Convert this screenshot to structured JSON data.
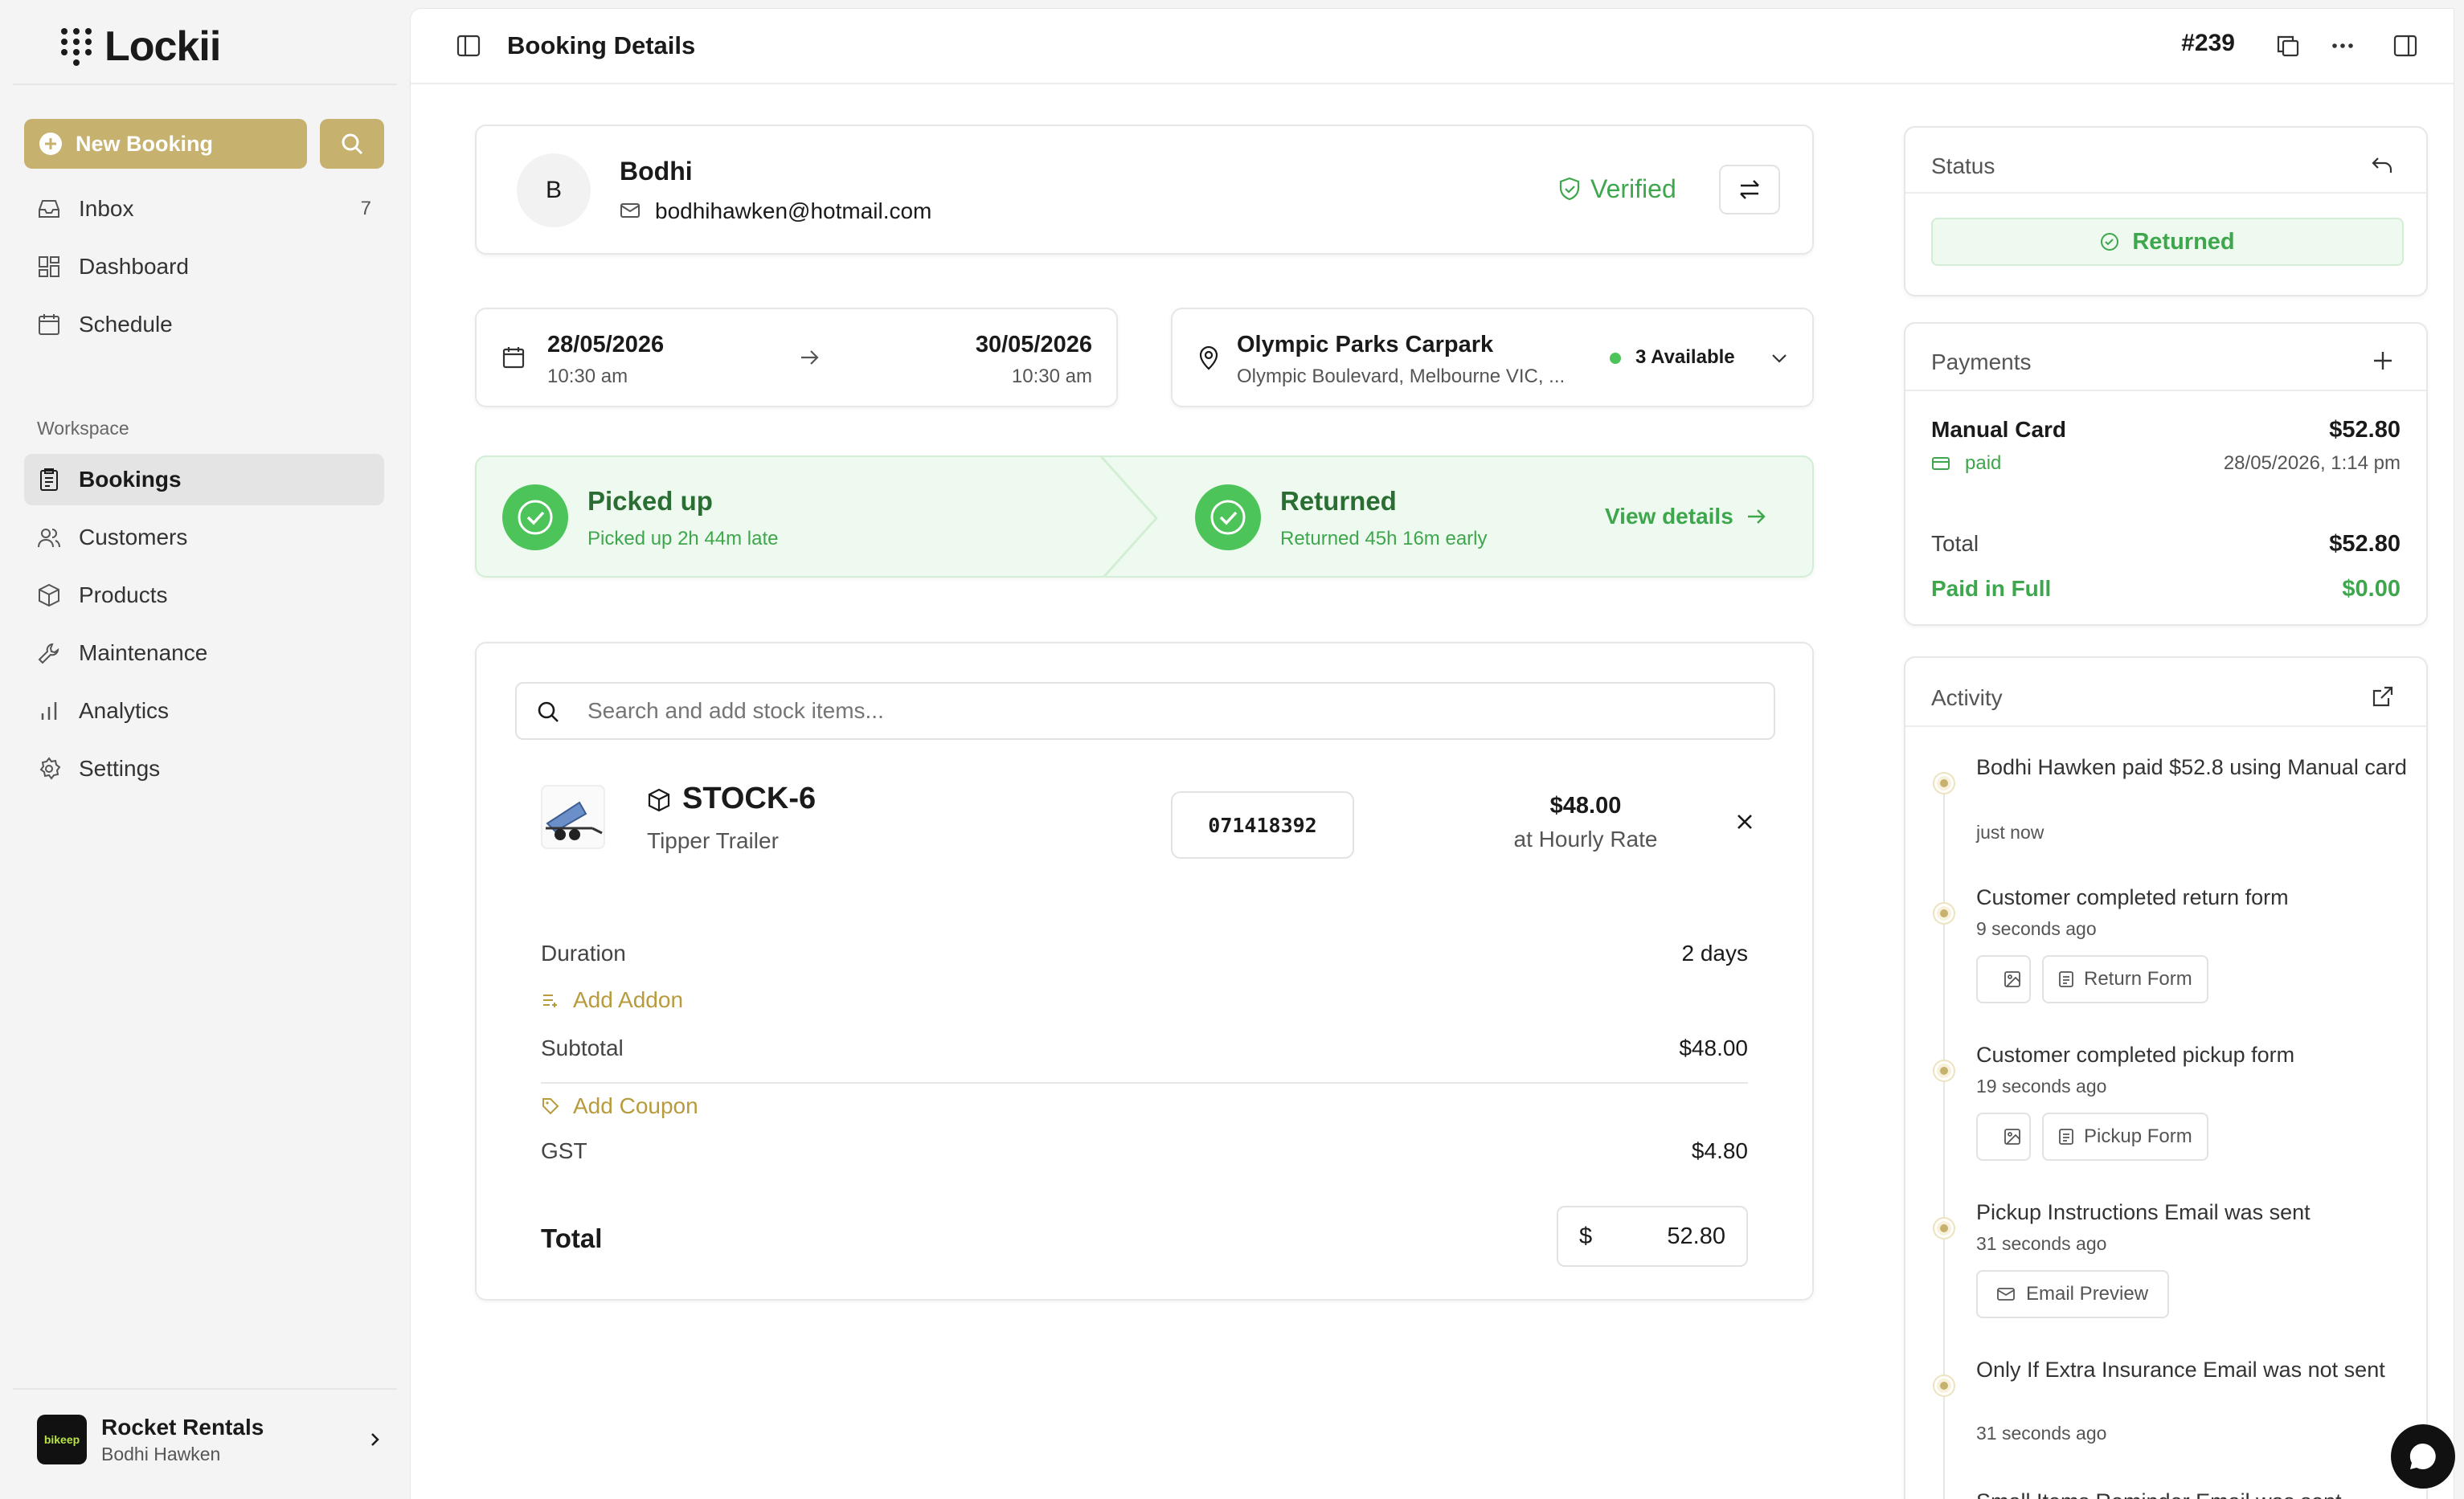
{
  "app": {
    "name": "Lockii"
  },
  "sidebar": {
    "new_booking_label": "New Booking",
    "items": [
      {
        "label": "Inbox",
        "count": "7"
      },
      {
        "label": "Dashboard"
      },
      {
        "label": "Schedule"
      }
    ],
    "workspace_label": "Workspace",
    "workspace_items": [
      {
        "label": "Bookings"
      },
      {
        "label": "Customers"
      },
      {
        "label": "Products"
      },
      {
        "label": "Maintenance"
      },
      {
        "label": "Analytics"
      },
      {
        "label": "Settings"
      }
    ],
    "org": {
      "logo_text": "bikeep",
      "name": "Rocket Rentals",
      "user": "Bodhi Hawken"
    }
  },
  "header": {
    "title": "Booking Details",
    "booking_number": "#239"
  },
  "customer": {
    "initial": "B",
    "name": "Bodhi",
    "email": "bodhihawken@hotmail.com",
    "verified_label": "Verified"
  },
  "dates": {
    "start_date": "28/05/2026",
    "start_time": "10:30 am",
    "end_date": "30/05/2026",
    "end_time": "10:30 am"
  },
  "location": {
    "name": "Olympic Parks Carpark",
    "address": "Olympic Boulevard, Melbourne VIC, ...",
    "availability": "3 Available"
  },
  "progress": {
    "picked_title": "Picked up",
    "picked_sub": "Picked up 2h 44m late",
    "returned_title": "Returned",
    "returned_sub": "Returned 45h 16m early",
    "view_details": "View details"
  },
  "items": {
    "search_placeholder": "Search and add stock items...",
    "stock": {
      "code": "STOCK-6",
      "type": "Tipper Trailer",
      "barcode": "071418392",
      "price": "$48.00",
      "rate": "at Hourly Rate"
    },
    "duration_label": "Duration",
    "duration_value": "2 days",
    "add_addon": "Add Addon",
    "subtotal_label": "Subtotal",
    "subtotal_value": "$48.00",
    "add_coupon": "Add Coupon",
    "gst_label": "GST",
    "gst_value": "$4.80",
    "total_label": "Total",
    "total_currency": "$",
    "total_value": "52.80"
  },
  "status": {
    "title": "Status",
    "value": "Returned"
  },
  "payments": {
    "title": "Payments",
    "method": "Manual Card",
    "amount": "$52.80",
    "state": "paid",
    "date": "28/05/2026, 1:14 pm",
    "total_label": "Total",
    "total_value": "$52.80",
    "paid_label": "Paid in Full",
    "paid_value": "$0.00"
  },
  "activity": {
    "title": "Activity",
    "events": [
      {
        "text": "Bodhi Hawken paid $52.8 using Manual card",
        "time": "just now"
      },
      {
        "text": "Customer completed return form",
        "time": "9 seconds ago",
        "attachment": "Return Form"
      },
      {
        "text": "Customer completed pickup form",
        "time": "19 seconds ago",
        "attachment": "Pickup Form"
      },
      {
        "text": "Pickup Instructions Email was sent",
        "time": "31 seconds ago",
        "attachment": "Email Preview"
      },
      {
        "text": "Only If Extra Insurance Email was not sent",
        "time": "31 seconds ago"
      },
      {
        "text": "Small Items Reminder Email was sent",
        "time": ""
      }
    ]
  },
  "colors": {
    "accent": "#c6b26e",
    "success": "#3ea64c",
    "success_bg": "#eefaef"
  }
}
